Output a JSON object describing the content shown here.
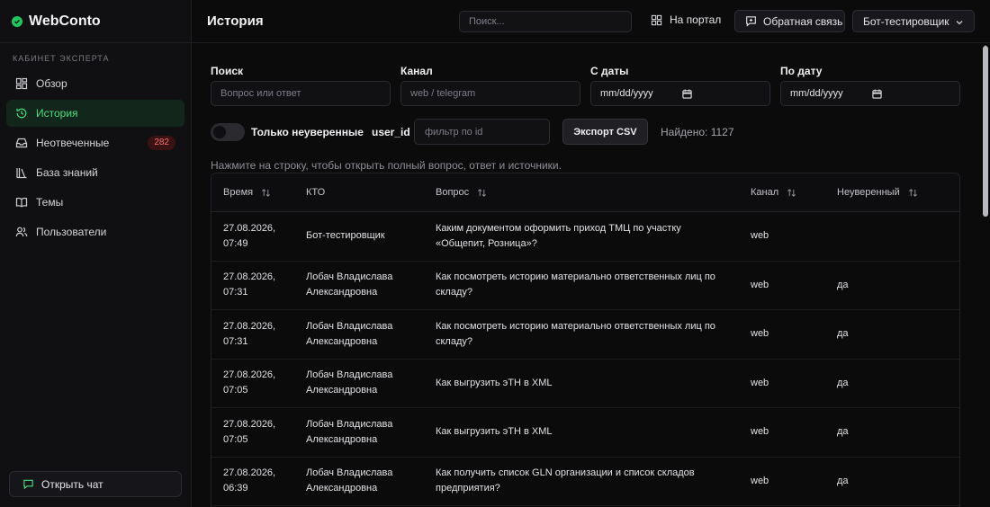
{
  "brand": {
    "name": "WebConto",
    "accent": "#22c55e"
  },
  "sidebar": {
    "section": "КАБИНЕТ ЭКСПЕРТА",
    "items": [
      {
        "label": "Обзор",
        "icon": "dashboard-icon"
      },
      {
        "label": "История",
        "icon": "history-icon",
        "active": true
      },
      {
        "label": "Неотвеченные",
        "icon": "inbox-icon",
        "badge": "282"
      },
      {
        "label": "База знаний",
        "icon": "library-icon"
      },
      {
        "label": "Темы",
        "icon": "book-icon"
      },
      {
        "label": "Пользователи",
        "icon": "users-icon"
      }
    ],
    "open_chat": "Открыть чат"
  },
  "header": {
    "title": "История",
    "search_placeholder": "Поиск...",
    "portal": "На портал",
    "feedback": "Обратная связь",
    "user": "Бот-тестировщик"
  },
  "filters": {
    "search": {
      "label": "Поиск",
      "placeholder": "Вопрос или ответ"
    },
    "channel": {
      "label": "Канал",
      "placeholder": "web / telegram"
    },
    "from": {
      "label": "С даты",
      "value": "mm/dd/yyyy"
    },
    "to": {
      "label": "По дату",
      "value": "mm/dd/yyyy"
    },
    "uncertain_only": {
      "label": "Только неуверенные",
      "on": false
    },
    "user_id": {
      "label": "user_id",
      "placeholder": "фильтр по id"
    },
    "export": "Экспорт CSV",
    "found": "Найдено: 1127"
  },
  "hint": "Нажмите на строку, чтобы открыть полный вопрос, ответ и источники.",
  "table": {
    "columns": [
      "Время",
      "КТО",
      "Вопрос",
      "Канал",
      "Неуверенный"
    ],
    "rows": [
      {
        "time1": "27.08.2026,",
        "time2": "07:49",
        "who1": "Бот-тестировщик",
        "who2": "",
        "q1": "Каким документом оформить приход ТМЦ по участку",
        "q2": "«Общепит, Розница»?",
        "channel": "web",
        "uncertain": ""
      },
      {
        "time1": "27.08.2026,",
        "time2": "07:31",
        "who1": "Лобач Владислава",
        "who2": "Александровна",
        "q1": "Как посмотреть историю материально ответственных лиц по",
        "q2": "складу?",
        "channel": "web",
        "uncertain": "да"
      },
      {
        "time1": "27.08.2026,",
        "time2": "07:31",
        "who1": "Лобач Владислава",
        "who2": "Александровна",
        "q1": "Как посмотреть историю материально ответственных лиц по",
        "q2": "складу?",
        "channel": "web",
        "uncertain": "да"
      },
      {
        "time1": "27.08.2026,",
        "time2": "07:05",
        "who1": "Лобач Владислава",
        "who2": "Александровна",
        "q1": "Как выгрузить эТН в XML",
        "q2": "",
        "channel": "web",
        "uncertain": "да"
      },
      {
        "time1": "27.08.2026,",
        "time2": "07:05",
        "who1": "Лобач Владислава",
        "who2": "Александровна",
        "q1": "Как выгрузить эТН в XML",
        "q2": "",
        "channel": "web",
        "uncertain": "да"
      },
      {
        "time1": "27.08.2026,",
        "time2": "06:39",
        "who1": "Лобач Владислава",
        "who2": "Александровна",
        "q1": "Как получить список GLN организации и список складов",
        "q2": "предприятия?",
        "channel": "web",
        "uncertain": "да"
      }
    ]
  }
}
